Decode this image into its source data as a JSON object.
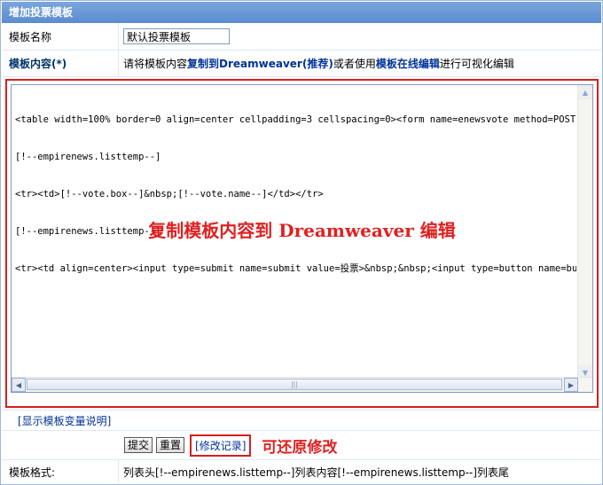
{
  "header": {
    "title": "增加投票模板"
  },
  "name_row": {
    "label": "模板名称",
    "value": "默认投票模板"
  },
  "content_row": {
    "label": "模板内容(*)",
    "hint_prefix": "请将模板内容",
    "hint_bold1": "复制到Dreamweaver(推荐)",
    "hint_mid": "或者使用",
    "hint_bold2": "模板在线编辑",
    "hint_suffix": "进行可视化编辑"
  },
  "editor": {
    "lines": [
      "<table width=100% border=0 align=center cellpadding=3 cellspacing=0><form name=enewsvote method=POST ac",
      "[!--empirenews.listtemp--]",
      "<tr><td>[!--vote.box--]&nbsp;[!--vote.name--]</td></tr>",
      "[!--empirenews.listtemp--]",
      "<tr><td align=center><input type=submit name=submit value=投票>&nbsp;&nbsp;<input type=button name=bu"
    ],
    "overlay_note": "复制模板内容到 Dreamweaver 编辑"
  },
  "vars_link": {
    "text": "[显示模板变量说明]"
  },
  "actions": {
    "submit": "提交",
    "reset": "重置",
    "history": "[修改记录]",
    "restore_note": "可还原修改"
  },
  "format_row": {
    "label": "模板格式:",
    "value": "列表头[!--empirenews.listtemp--]列表内容[!--empirenews.listtemp--]列表尾"
  },
  "colors": {
    "title_bar": "#5b8ccf",
    "accent_red": "#d32020",
    "link_blue": "#003399"
  },
  "icons": {
    "scroll_up": "arrow-up-icon",
    "scroll_down": "arrow-down-icon",
    "scroll_left": "arrow-left-icon",
    "scroll_right": "arrow-right-icon"
  }
}
